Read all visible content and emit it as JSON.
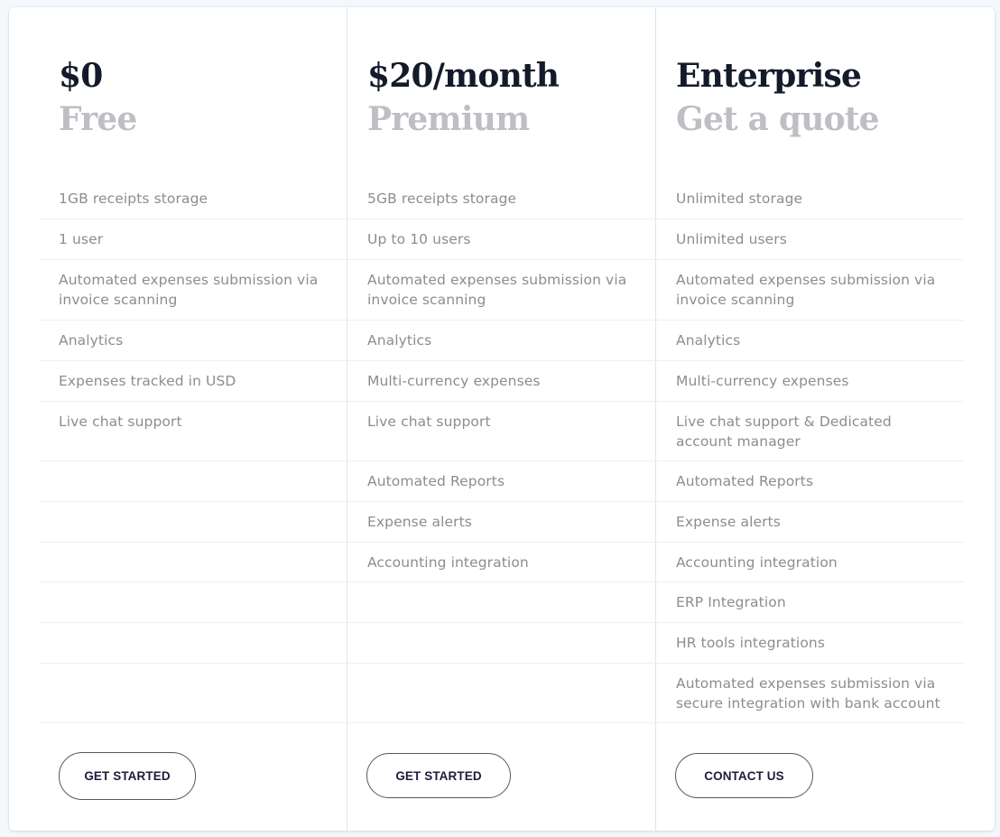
{
  "plans": [
    {
      "price": "$0",
      "name": "Free",
      "features": [
        "1GB receipts storage",
        "1 user",
        "Automated expenses submission via invoice scanning",
        "Analytics",
        "Expenses tracked in USD",
        "Live chat support",
        "",
        "",
        "",
        "",
        "",
        ""
      ],
      "cta": "GET STARTED"
    },
    {
      "price": "$20/month",
      "name": "Premium",
      "features": [
        "5GB receipts storage",
        "Up to 10 users",
        "Automated expenses submission via invoice scanning",
        "Analytics",
        "Multi-currency expenses",
        "Live chat support",
        "Automated Reports",
        "Expense alerts",
        "Accounting integration",
        "",
        "",
        ""
      ],
      "cta": "GET STARTED"
    },
    {
      "price": "Enterprise",
      "name": "Get a quote",
      "features": [
        "Unlimited storage",
        "Unlimited users",
        "Automated expenses submission via invoice scanning",
        "Analytics",
        "Multi-currency expenses",
        "Live chat support & Dedicated account manager",
        "Automated Reports",
        "Expense alerts",
        "Accounting integration",
        "ERP Integration",
        "HR tools integrations",
        "Automated expenses submission via secure integration with bank account"
      ],
      "cta": "CONTACT US"
    }
  ],
  "colors": {
    "page_bg": "#f4f8fb",
    "price_text": "#131a2a",
    "subtitle_text": "#bdbfc4",
    "feature_text": "#8a8d93",
    "button_text": "#1c1e3a",
    "button_border": "#545668"
  }
}
